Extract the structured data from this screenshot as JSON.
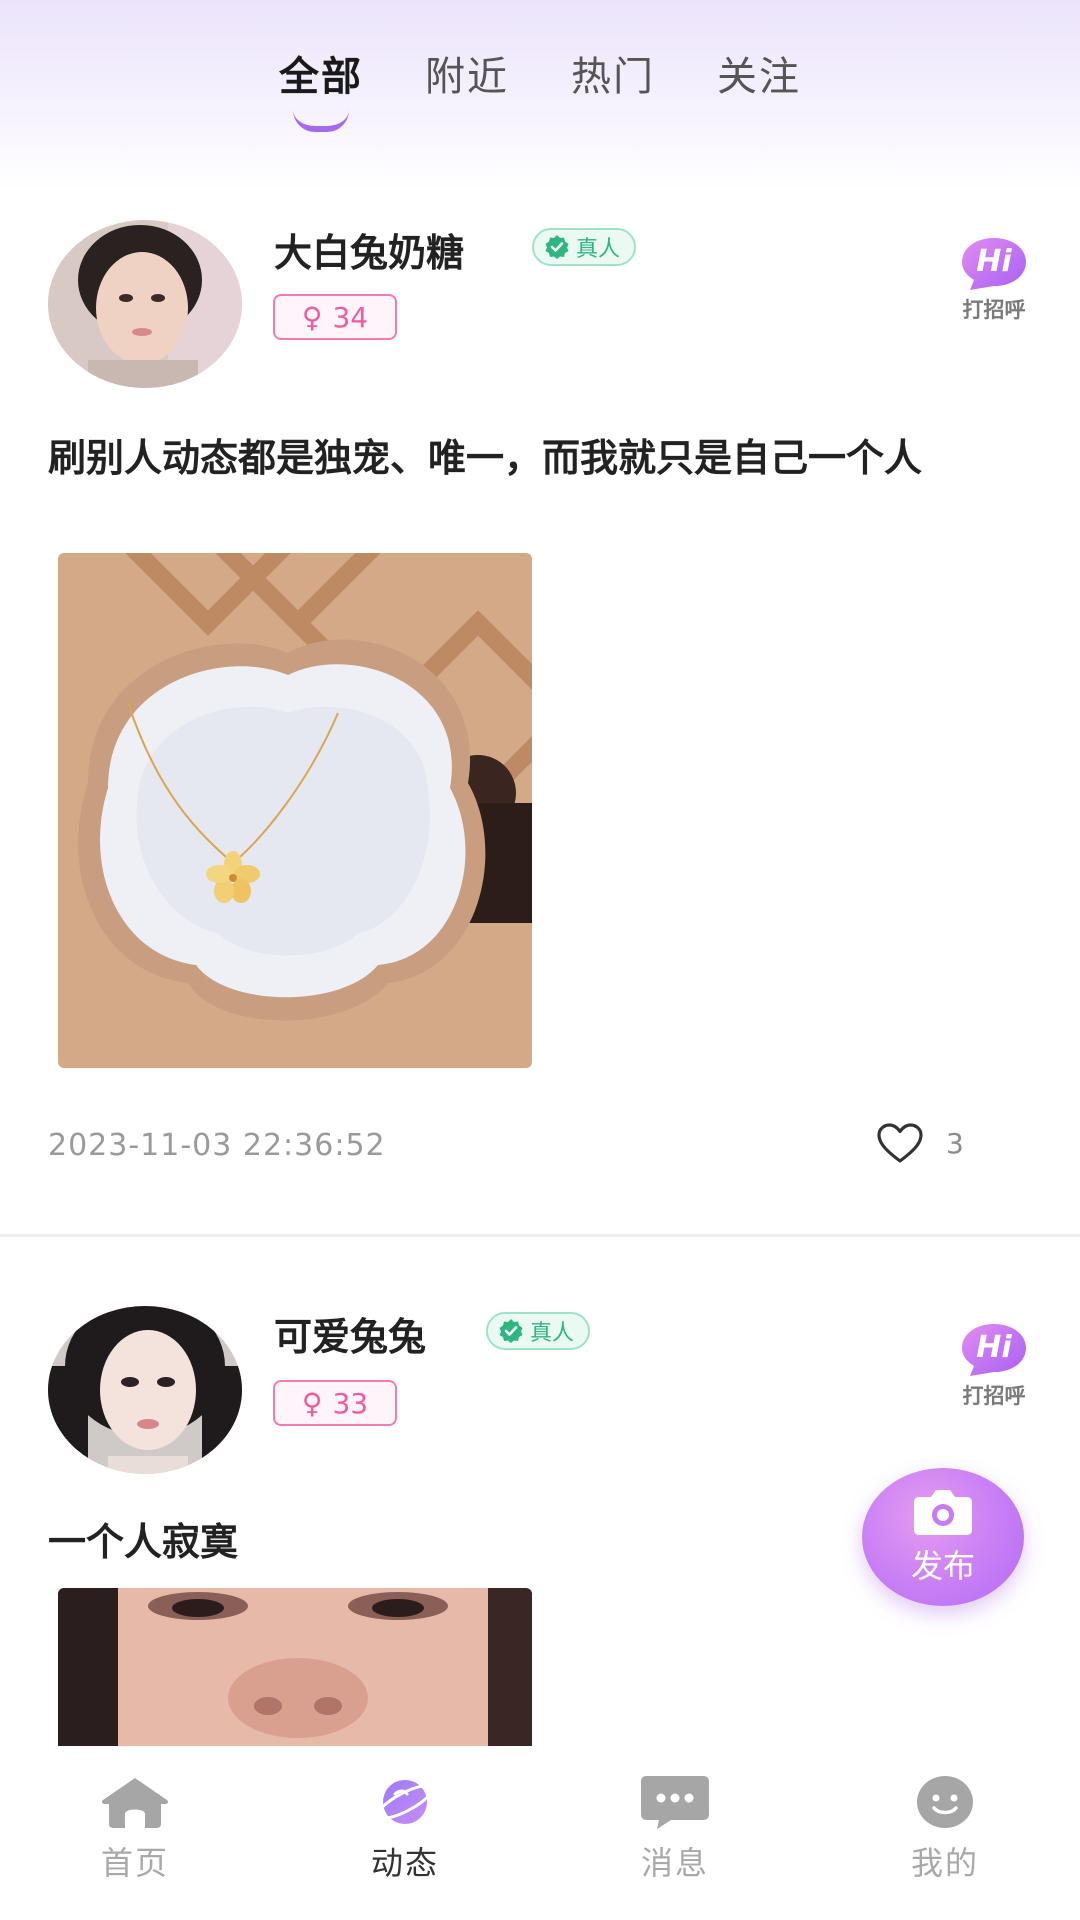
{
  "tabs": [
    {
      "label": "全部",
      "active": true
    },
    {
      "label": "附近",
      "active": false
    },
    {
      "label": "热门",
      "active": false
    },
    {
      "label": "关注",
      "active": false
    }
  ],
  "posts": [
    {
      "username": "大白兔奶糖",
      "verified_label": "真人",
      "gender_symbol": "♀",
      "age": "34",
      "hi_label": "打招呼",
      "hi_text": "Hi",
      "text": "刷别人动态都是独宠、唯一，而我就只是自己一个人",
      "timestamp": "2023-11-03 22:36:52",
      "likes": "3"
    },
    {
      "username": "可爱兔兔",
      "verified_label": "真人",
      "gender_symbol": "♀",
      "age": "33",
      "hi_label": "打招呼",
      "hi_text": "Hi",
      "text": "一个人寂寞"
    }
  ],
  "publish": {
    "label": "发布",
    "icon": "camera-icon"
  },
  "bottom_nav": [
    {
      "label": "首页",
      "icon": "home-icon",
      "active": false
    },
    {
      "label": "动态",
      "icon": "planet-icon",
      "active": true
    },
    {
      "label": "消息",
      "icon": "message-icon",
      "active": false
    },
    {
      "label": "我的",
      "icon": "profile-face-icon",
      "active": false
    }
  ],
  "colors": {
    "accent": "#b36cf4",
    "female_badge": "#f05aa0",
    "verified_green": "#2db582",
    "inactive_nav": "#a9a9a9"
  }
}
